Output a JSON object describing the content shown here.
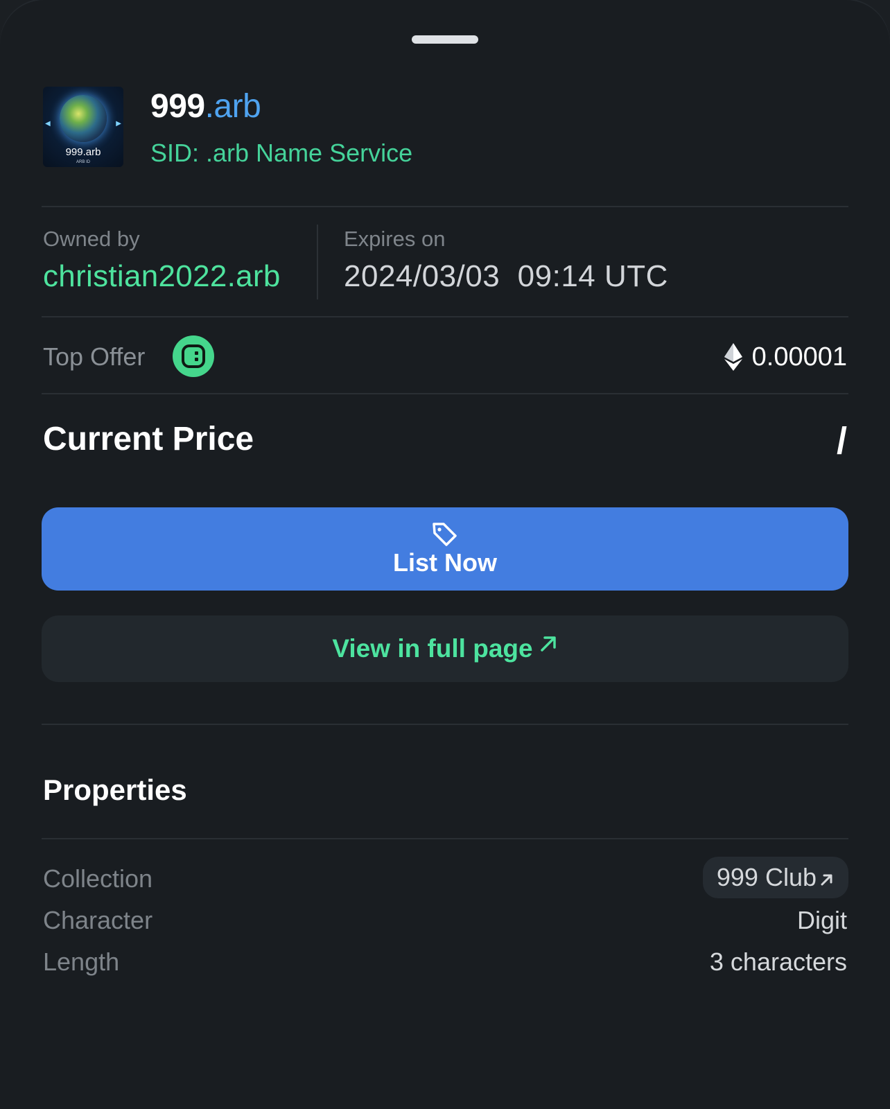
{
  "domain": {
    "name": "999",
    "tld": ".arb",
    "service": "SID: .arb Name Service",
    "thumbnail_caption": "999.arb",
    "thumbnail_sub": "ARB ID"
  },
  "ownership": {
    "owned_label": "Owned by",
    "owner": "christian2022.arb",
    "expires_label": "Expires on",
    "expires_value": "2024/03/03  09:14 UTC"
  },
  "offer": {
    "label": "Top Offer",
    "icon": "marketplace-logo-icon",
    "currency_icon": "ethereum-icon",
    "amount": "0.00001"
  },
  "price": {
    "label": "Current Price",
    "value": "/"
  },
  "actions": {
    "list_label": "List Now",
    "list_icon": "price-tag-icon",
    "view_label": "View in full page",
    "view_icon": "external-arrow-icon"
  },
  "properties": {
    "title": "Properties",
    "rows": [
      {
        "label": "Collection",
        "value": "999 Club"
      },
      {
        "label": "Character",
        "value": "Digit"
      },
      {
        "label": "Length",
        "value": "3 characters"
      }
    ]
  },
  "colors": {
    "background": "#191d21",
    "accent_green": "#4ee39e",
    "accent_blue": "#437de0",
    "tld_blue": "#4fa3f0"
  }
}
